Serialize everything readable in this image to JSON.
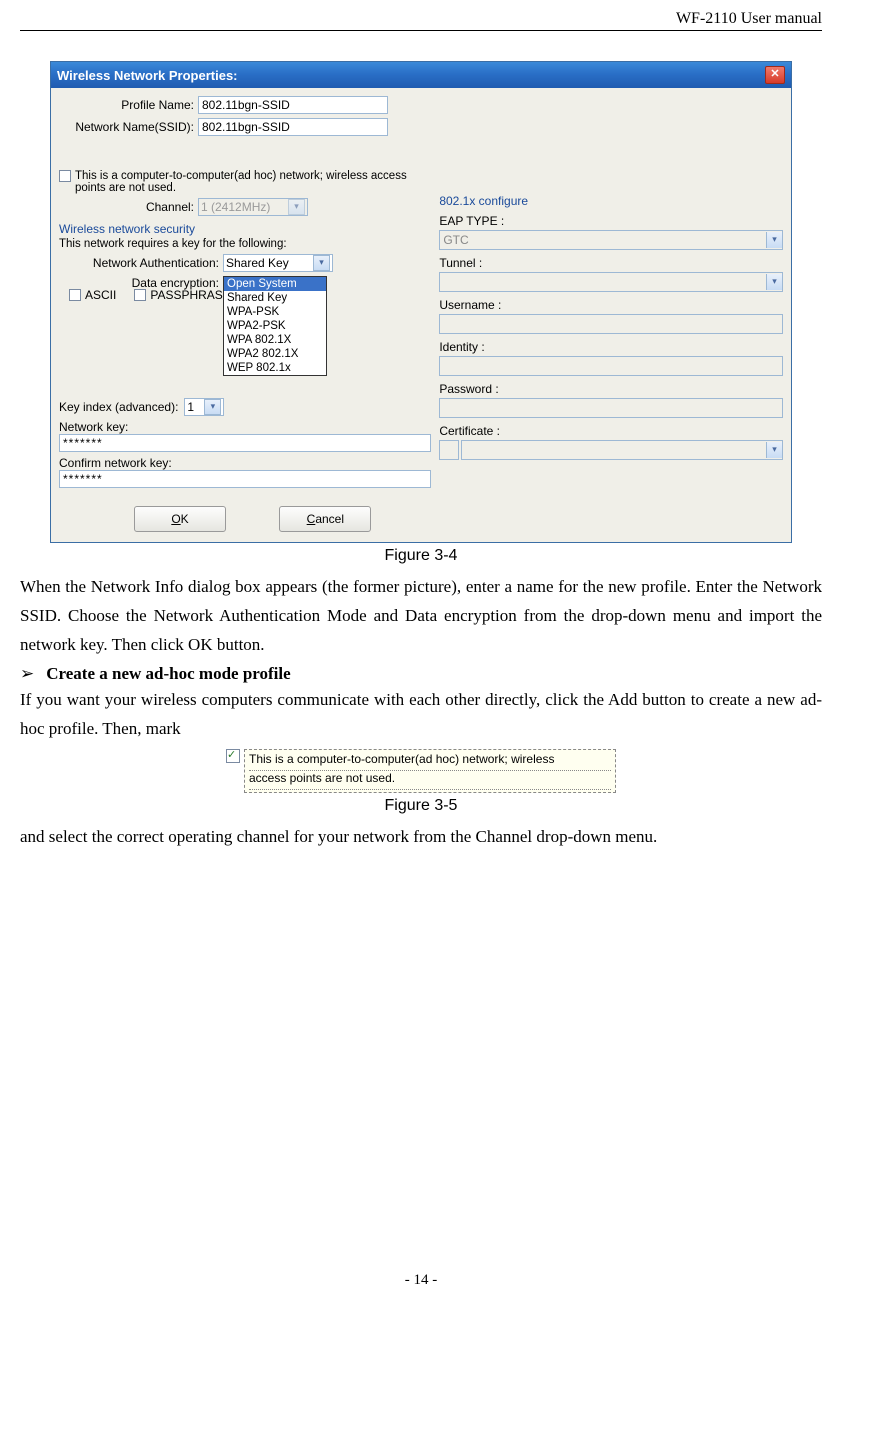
{
  "header": {
    "doc_title": "WF-2110 User manual"
  },
  "window": {
    "title": "Wireless Network Properties:",
    "profile_name_label": "Profile Name:",
    "profile_name_value": "802.11bgn-SSID",
    "ssid_label": "Network Name(SSID):",
    "ssid_value": "802.11bgn-SSID",
    "adhoc_text": "This is a computer-to-computer(ad hoc) network; wireless access points are not used.",
    "channel_label": "Channel:",
    "channel_value": "1  (2412MHz)",
    "security_group": "Wireless network security",
    "security_text": "This network requires a key for the following:",
    "auth_label": "Network Authentication:",
    "auth_value": "Shared Key",
    "enc_label": "Data encryption:",
    "ascii_label": "ASCII",
    "passphrase_label": "PASSPHRASE",
    "auth_options": [
      "Open System",
      "Shared Key",
      "WPA-PSK",
      "WPA2-PSK",
      "WPA 802.1X",
      "WPA2 802.1X",
      "WEP 802.1x"
    ],
    "keyindex_label": "Key index (advanced):",
    "keyindex_value": "1",
    "netkey_label": "Network key:",
    "netkey_value": "*******",
    "confkey_label": "Confirm network key:",
    "confkey_value": "*******",
    "ok_u": "O",
    "ok_rest": "K",
    "cancel_u": "C",
    "cancel_rest": "ancel",
    "dotx_group": "802.1x configure",
    "eap_label": "EAP TYPE :",
    "eap_value": "GTC",
    "tunnel_label": "Tunnel :",
    "username_label": "Username :",
    "identity_label": "Identity :",
    "password_label": "Password :",
    "cert_label": "Certificate :"
  },
  "captions": {
    "fig34": "Figure 3-4",
    "fig35": "Figure 3-5"
  },
  "para1": "When the Network Info dialog box appears (the former picture), enter a name for the new profile. Enter the Network SSID. Choose the Network Authentication Mode and Data encryption from the drop-down menu and import the network key. Then click OK button.",
  "bullet_text": "Create a new ad-hoc mode profile",
  "para2": "If you want your wireless computers communicate with each other directly, click the Add button to create a new ad-hoc profile. Then, mark",
  "adhoc_tip_line1": "This is a computer-to-computer(ad hoc) network; wireless",
  "adhoc_tip_line2": "access points are not used.",
  "para3": "and select the correct operating channel for your network from the Channel drop-down menu.",
  "footer": {
    "page": "- 14 -"
  }
}
